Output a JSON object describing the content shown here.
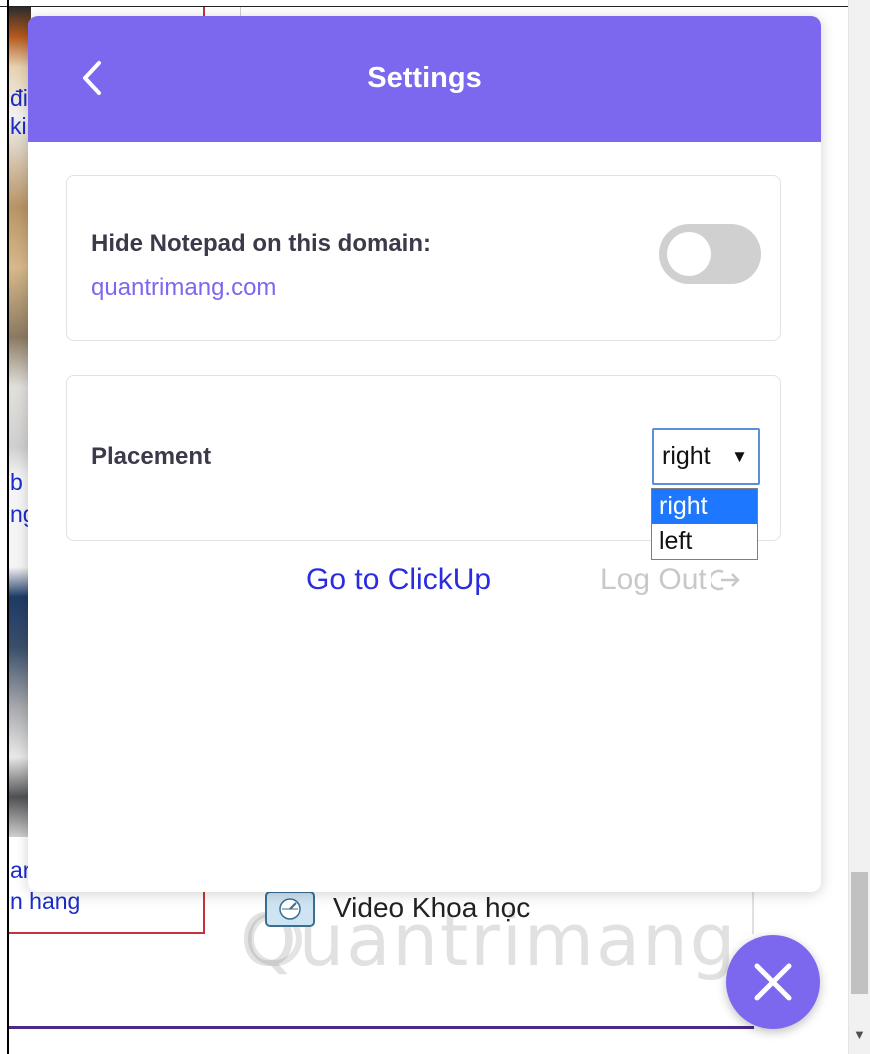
{
  "background": {
    "fragments": [
      {
        "text": "đi"
      },
      {
        "text": "ki"
      },
      {
        "text": "b"
      },
      {
        "text": "ng"
      },
      {
        "text": "ar"
      },
      {
        "text": "n hang"
      }
    ],
    "video_label": "Video Khoa học",
    "watermark": "Quantrimang"
  },
  "settings": {
    "title": "Settings",
    "back_icon": "chevron-left-icon",
    "hide_notepad": {
      "label": "Hide Notepad on this domain:",
      "domain": "quantrimang.com",
      "enabled": false
    },
    "placement": {
      "label": "Placement",
      "selected": "right",
      "options": [
        "right",
        "left"
      ]
    },
    "goto_label": "Go to ClickUp",
    "logout_label": "Log Out",
    "logout_icon": "logout-arrow-icon"
  },
  "close_icon": "close-icon",
  "colors": {
    "accent": "#7b68ee",
    "link_blue": "#2b2be0",
    "option_highlight": "#1e78ff",
    "muted": "#c8c8c8"
  }
}
